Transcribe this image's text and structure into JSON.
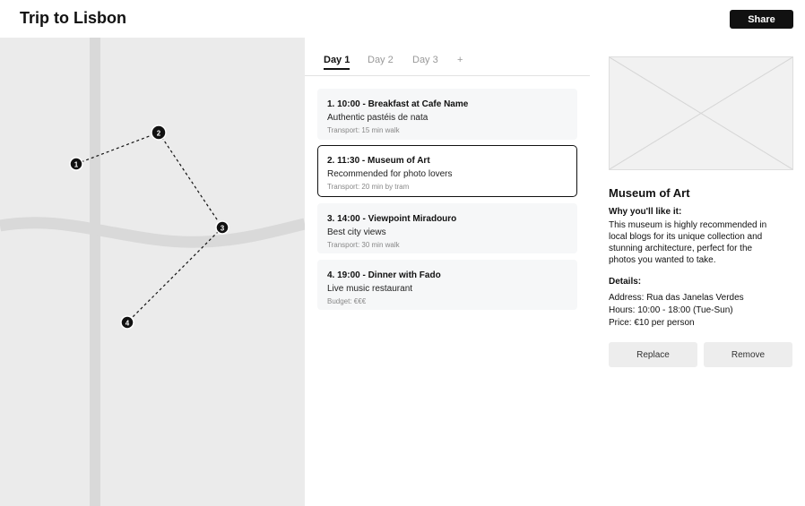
{
  "header": {
    "title": "Trip to Lisbon",
    "share_label": "Share"
  },
  "map": {
    "markers": [
      "1",
      "2",
      "3",
      "4"
    ]
  },
  "tabs": [
    {
      "label": "Day 1",
      "active": true
    },
    {
      "label": "Day 2",
      "active": false
    },
    {
      "label": "Day 3",
      "active": false
    },
    {
      "label": "+",
      "active": false
    }
  ],
  "stops": [
    {
      "title": "1. 10:00 - Breakfast at Cafe Name",
      "description": "Authentic pastéis de nata",
      "meta": "Transport: 15 min walk",
      "selected": false
    },
    {
      "title": "2. 11:30 - Museum of Art",
      "description": "Recommended for photo lovers",
      "meta": "Transport: 20 min by tram",
      "selected": true
    },
    {
      "title": "3. 14:00 - Viewpoint Miradouro",
      "description": "Best city views",
      "meta": "Transport: 30 min walk",
      "selected": false
    },
    {
      "title": "4. 19:00 - Dinner with Fado",
      "description": "Live music restaurant",
      "meta": "Budget: €€€",
      "selected": false
    }
  ],
  "details": {
    "name": "Museum of Art",
    "why_label": "Why you'll like it:",
    "why_text": "This museum is highly recommended in local blogs for its unique collection and stunning architecture, perfect for the photos you wanted to take.",
    "details_label": "Details:",
    "address": "Address: Rua das Janelas Verdes",
    "hours": "Hours: 10:00 - 18:00 (Tue-Sun)",
    "price": "Price: €10 per person",
    "replace_label": "Replace",
    "remove_label": "Remove"
  }
}
